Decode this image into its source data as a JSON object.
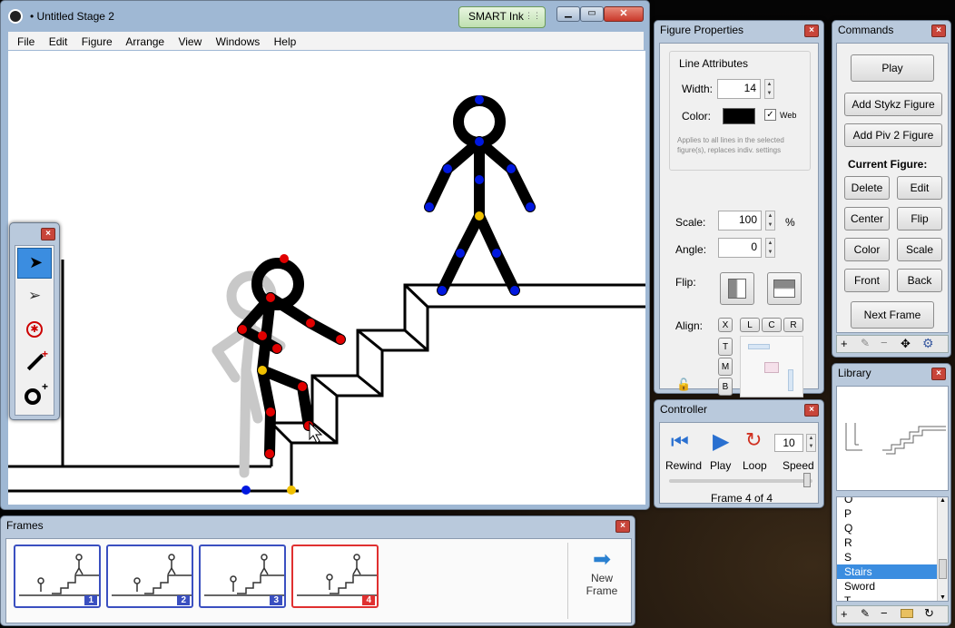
{
  "main_window": {
    "title": "• Untitled Stage 2",
    "menu": [
      "File",
      "Edit",
      "Figure",
      "Arrange",
      "View",
      "Windows",
      "Help"
    ],
    "smart_ink": "SMART Ink"
  },
  "figure_properties": {
    "title": "Figure Properties",
    "group_title": "Line Attributes",
    "width_label": "Width:",
    "width_value": "14",
    "color_label": "Color:",
    "color_value": "#000000",
    "web_label": "Web",
    "hint": "Applies to all lines in the selected figure(s), replaces indiv. settings",
    "scale_label": "Scale:",
    "scale_value": "100",
    "scale_unit": "%",
    "angle_label": "Angle:",
    "angle_value": "0",
    "flip_label": "Flip:",
    "align_label": "Align:",
    "align_buttons": [
      "X",
      "L",
      "C",
      "R",
      "T",
      "M",
      "B"
    ]
  },
  "commands": {
    "title": "Commands",
    "play": "Play",
    "add_stykz": "Add Stykz Figure",
    "add_piv": "Add Piv 2 Figure",
    "current_figure": "Current Figure:",
    "delete": "Delete",
    "edit": "Edit",
    "center": "Center",
    "flip": "Flip",
    "color": "Color",
    "scale": "Scale",
    "front": "Front",
    "back": "Back",
    "next_frame": "Next Frame"
  },
  "controller": {
    "title": "Controller",
    "rewind": "Rewind",
    "play": "Play",
    "loop": "Loop",
    "speed_value": "10",
    "speed": "Speed",
    "frame_status": "Frame 4 of 4",
    "speed_fraction": 1.0
  },
  "library": {
    "title": "Library",
    "items": [
      "O",
      "P",
      "Q",
      "R",
      "S",
      "Stairs",
      "Sword",
      "T"
    ],
    "selected": "Stairs"
  },
  "frames": {
    "title": "Frames",
    "numbers": [
      "1",
      "2",
      "3",
      "4"
    ],
    "new_frame_line1": "New",
    "new_frame_line2": "Frame"
  },
  "colors": {
    "joint_selected": "#e00000",
    "joint_other": "#0018e0",
    "joint_center": "#f0c000",
    "frame_selected": "#e03030",
    "frame_normal": "#3a4fc0",
    "ghost": "#c8c8c8"
  }
}
